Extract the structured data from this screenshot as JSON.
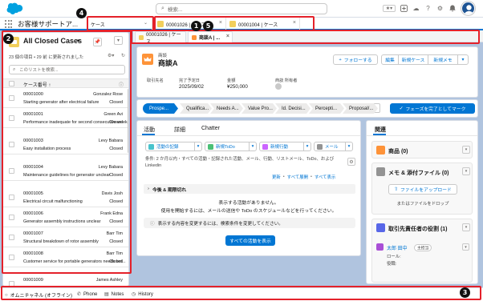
{
  "header": {
    "search_placeholder": "検索...",
    "icons": [
      "star-icon",
      "plus-icon",
      "cloud-icon",
      "help-icon",
      "gear-icon",
      "bell-icon"
    ]
  },
  "nav": {
    "app_name": "お客様サポートア...",
    "object_tab": "ケース",
    "tabs": [
      {
        "label": "00001026 | ケース",
        "color": "#f2cf5b"
      },
      {
        "label": "00001004 | ケース",
        "color": "#f2cf5b"
      }
    ]
  },
  "subtabs": [
    {
      "label": "00001026 | ケース"
    },
    {
      "label": "商談A | ..."
    }
  ],
  "list": {
    "title": "All Closed Cases",
    "subtitle": "23 個の項目 • 29 前 に更新されました",
    "search_placeholder": "このリストを検索...",
    "column_header": "ケース番号 ↑",
    "rows": [
      {
        "number": "00001000",
        "owner": "Gonzalez Rose",
        "subject": "Starting generator after electrical failure",
        "status": "Closed"
      },
      {
        "number": "00001001",
        "owner": "Green Avi",
        "subject": "Performance inadequate for second consecutive week",
        "status": "Closed"
      },
      {
        "number": "00001003",
        "owner": "Levy Babara",
        "subject": "Easy installation process",
        "status": "Closed"
      },
      {
        "number": "00001004",
        "owner": "Levy Babara",
        "subject": "Maintenance guidelines for generator unclear",
        "status": "Closed"
      },
      {
        "number": "00001005",
        "owner": "Davis Josh",
        "subject": "Electrical circuit malfunctioning",
        "status": "Closed"
      },
      {
        "number": "00001006",
        "owner": "Frank Edna",
        "subject": "Generator assembly instructions unclear",
        "status": "Closed"
      },
      {
        "number": "00001007",
        "owner": "Barr Tim",
        "subject": "Structural breakdown of rotor assembly",
        "status": "Closed"
      },
      {
        "number": "00001008",
        "owner": "Barr Tim",
        "subject": "Customer service for portable generators needs bet...",
        "status": "Closed"
      },
      {
        "number": "00001009",
        "owner": "James Ashley",
        "subject": "",
        "status": ""
      }
    ]
  },
  "record": {
    "object_label": "商談",
    "name": "商談A",
    "buttons": {
      "follow": "フォローする",
      "edit": "編集",
      "new_case": "新規ケース",
      "new_memo": "新規メモ"
    },
    "fields": [
      {
        "label": "取引先名",
        "value": ""
      },
      {
        "label": "完了予定日",
        "value": "2025/09/02"
      },
      {
        "label": "金額",
        "value": "¥250,000"
      },
      {
        "label": "商談 所有者",
        "value": ""
      }
    ],
    "path": [
      "Prospe...",
      "Qualifica...",
      "Needs A...",
      "Value Pro...",
      "Id. Decisi...",
      "Percepti...",
      "Proposal/..."
    ],
    "complete_button": "フェーズを完了としてマーク"
  },
  "activity": {
    "tabs": [
      "活動",
      "詳細",
      "Chatter"
    ],
    "actions": [
      "活動の記録",
      "新規ToDo",
      "新規行動",
      "メール"
    ],
    "filter_text": "条件: 2 か月以内・すべての活動・記録された活動、メール、行動、リストメール、ToDo、および Linkedin",
    "links": [
      "更新",
      "すべて展開",
      "すべて表示"
    ],
    "section_title": "今後 & 期限切れ",
    "empty_line1": "表示する活動がありません。",
    "empty_line2": "使用を開始するには、メールの送信や ToDo のスケジュールなどを行ってください。",
    "info_text": "表示する内容を変更するには、検索条件を変更してください。",
    "show_all_button": "すべての活動を表示"
  },
  "related": {
    "tab": "関連",
    "products": "商品 (0)",
    "notes_files": "メモ & 添付ファイル (0)",
    "upload_button": "ファイルをアップロード",
    "drop_text": "またはファイルをドロップ",
    "contact_roles": "取引先責任者の役割 (1)",
    "contact_name": "太郎 田中",
    "contact_badge": "主担当",
    "role_label": "ロール:",
    "title_label": "役職:"
  },
  "utility_bar": {
    "omni": "オムニチャネル (オフライン)",
    "phone": "Phone",
    "notes": "Notes",
    "history": "History"
  },
  "annotations": [
    "1",
    "2",
    "3",
    "4",
    "5"
  ],
  "colors": {
    "brand_blue": "#0176d3",
    "annotation_red": "#e4212a",
    "opportunity_orange": "#fe9339"
  }
}
